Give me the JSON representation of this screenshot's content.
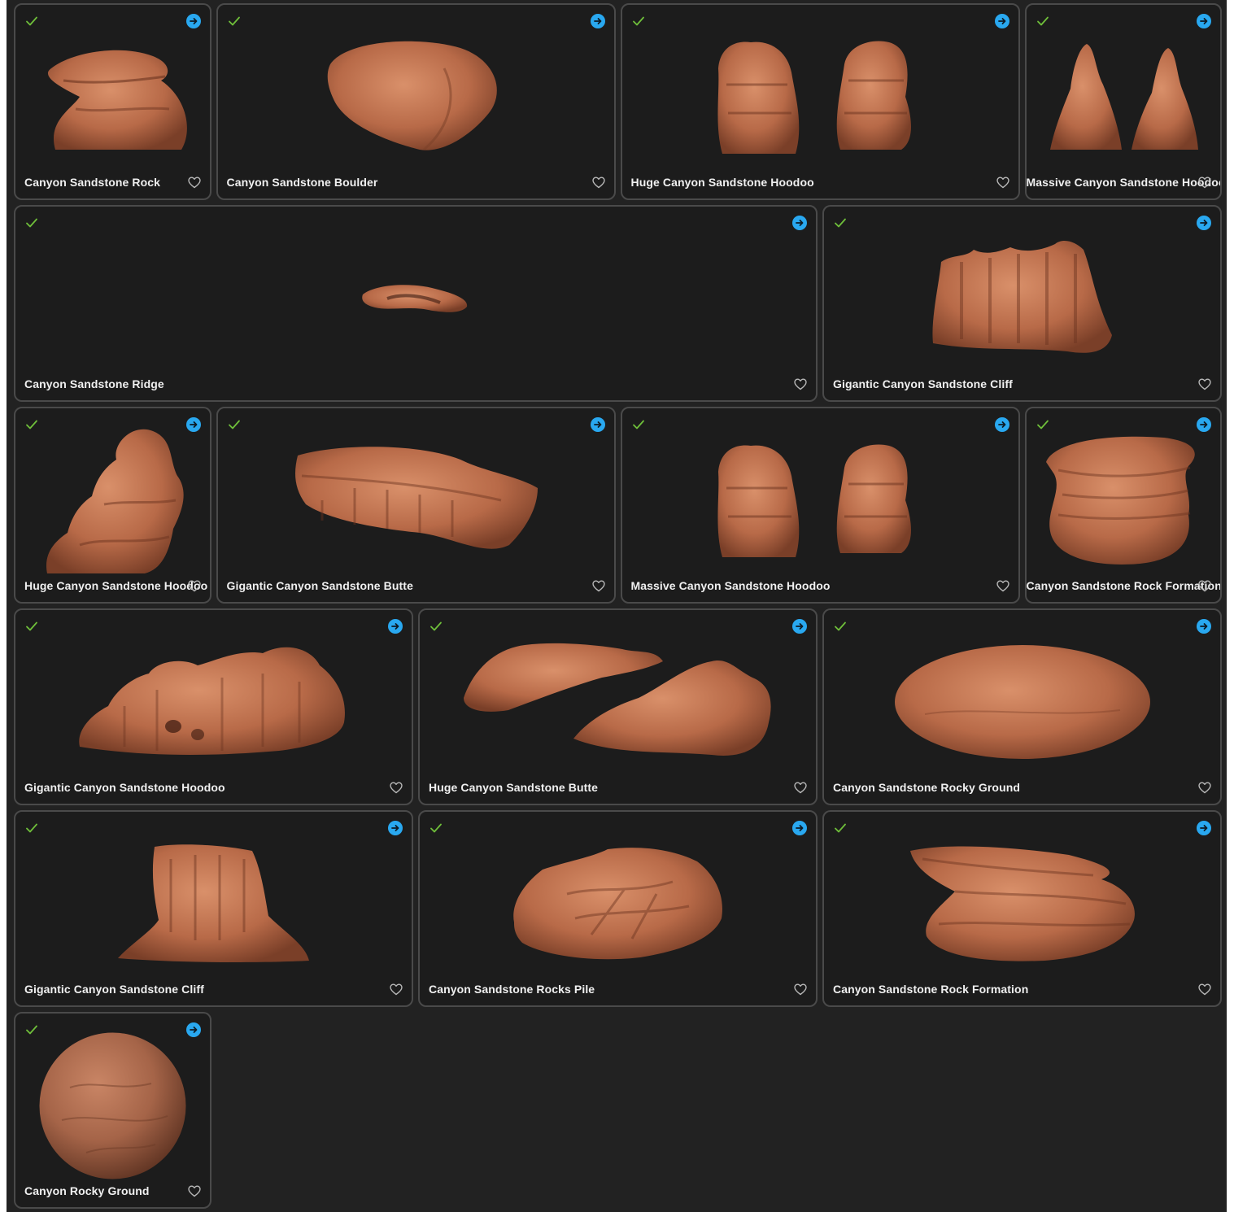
{
  "colors": {
    "panel_bg": "#222222",
    "card_bg": "#1c1c1c",
    "card_border": "#4a4a4a",
    "check": "#6fbf3a",
    "action_button": "#29a8f0",
    "title_text": "#f0f0f0",
    "heart_outline": "#b8b8b8"
  },
  "icons": {
    "status": "checkmark-icon",
    "action": "arrow-right-circle-icon",
    "favorite": "heart-outline-icon"
  },
  "assets": [
    {
      "title": "Canyon Sandstone Rock",
      "span": 1,
      "thumbnail": "stacked-rock"
    },
    {
      "title": "Canyon Sandstone Boulder",
      "span": 2,
      "thumbnail": "boulder"
    },
    {
      "title": "Huge Canyon Sandstone Hoodoo",
      "span": 2,
      "thumbnail": "twin-hoodoo"
    },
    {
      "title": "Massive Canyon Sandstone Hoodoo",
      "span": 1,
      "thumbnail": "twin-spire"
    },
    {
      "title": "Canyon Sandstone Ridge",
      "span": 4,
      "thumbnail": "thin-ridge"
    },
    {
      "title": "Gigantic Canyon Sandstone Cliff",
      "span": 2,
      "thumbnail": "cliff-wall"
    },
    {
      "title": "Huge Canyon Sandstone Hoodoo",
      "span": 1,
      "thumbnail": "tall-hoodoo"
    },
    {
      "title": "Gigantic Canyon Sandstone Butte",
      "span": 2,
      "thumbnail": "long-butte"
    },
    {
      "title": "Massive Canyon Sandstone Hoodoo",
      "span": 2,
      "thumbnail": "twin-hoodoo"
    },
    {
      "title": "Canyon Sandstone Rock Formation",
      "span": 1,
      "thumbnail": "mesa-rock"
    },
    {
      "title": "Gigantic Canyon Sandstone Hoodoo",
      "span": 2,
      "thumbnail": "wide-hoodoo"
    },
    {
      "title": "Huge Canyon Sandstone Butte",
      "span": 2,
      "thumbnail": "split-butte"
    },
    {
      "title": "Canyon Sandstone Rocky Ground",
      "span": 2,
      "thumbnail": "ground-disc"
    },
    {
      "title": "Gigantic Canyon Sandstone Cliff",
      "span": 2,
      "thumbnail": "cliff-block"
    },
    {
      "title": "Canyon Sandstone Rocks Pile",
      "span": 2,
      "thumbnail": "rock-pile"
    },
    {
      "title": "Canyon Sandstone Rock Formation",
      "span": 2,
      "thumbnail": "layered-slab"
    },
    {
      "title": "Canyon Rocky Ground",
      "span": 1,
      "thumbnail": "material-sphere"
    }
  ]
}
